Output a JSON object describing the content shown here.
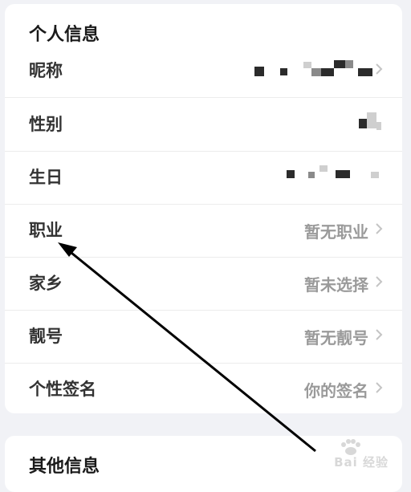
{
  "personal_info": {
    "title": "个人信息",
    "rows": [
      {
        "label": "昵称",
        "value": ""
      },
      {
        "label": "性别",
        "value": ""
      },
      {
        "label": "生日",
        "value": ""
      },
      {
        "label": "职业",
        "value": "暂无职业"
      },
      {
        "label": "家乡",
        "value": "暂未选择"
      },
      {
        "label": "靓号",
        "value": "暂无靓号"
      },
      {
        "label": "个性签名",
        "value": "你的签名"
      }
    ]
  },
  "other_info": {
    "title": "其他信息"
  },
  "icons": {
    "chevron": "chevron-right-icon"
  },
  "watermark": {
    "text": "Bai 经验"
  },
  "colors": {
    "background": "#f1f2f6",
    "card": "#ffffff",
    "label": "#333333",
    "value": "#9a9a9a",
    "arrow": "#000000"
  }
}
